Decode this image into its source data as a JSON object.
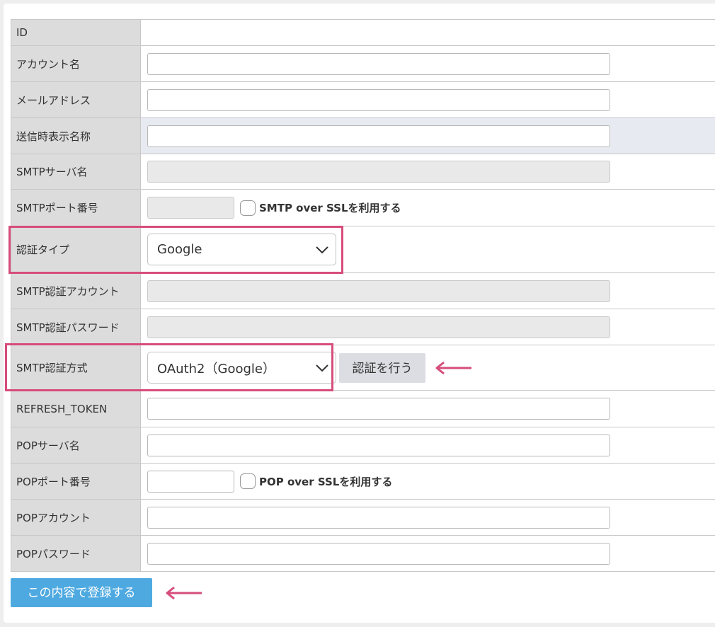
{
  "form": {
    "rows": [
      {
        "label": "ID"
      },
      {
        "label": "アカウント名"
      },
      {
        "label": "メールアドレス"
      },
      {
        "label": "送信時表示名称"
      },
      {
        "label": "SMTPサーバ名"
      },
      {
        "label": "SMTPポート番号",
        "checkbox_label": "SMTP over SSLを利用する"
      },
      {
        "label": "認証タイプ",
        "select_value": "Google"
      },
      {
        "label": "SMTP認証アカウント"
      },
      {
        "label": "SMTP認証パスワード"
      },
      {
        "label": "SMTP認証方式",
        "select_value": "OAuth2（Google）",
        "button_label": "認証を行う"
      },
      {
        "label": "REFRESH_TOKEN"
      },
      {
        "label": "POPサーバ名"
      },
      {
        "label": "POPポート番号",
        "checkbox_label": "POP over SSLを利用する"
      },
      {
        "label": "POPアカウント"
      },
      {
        "label": "POPパスワード"
      }
    ]
  },
  "submit_label": "この内容で登録する",
  "colors": {
    "highlight": "#d64d7a",
    "submit": "#4ea9e1",
    "label_bg": "#dcdcdc"
  },
  "icons": {
    "select_arrow": "chevron-down-icon",
    "annotation_arrow": "arrow-left-icon"
  }
}
